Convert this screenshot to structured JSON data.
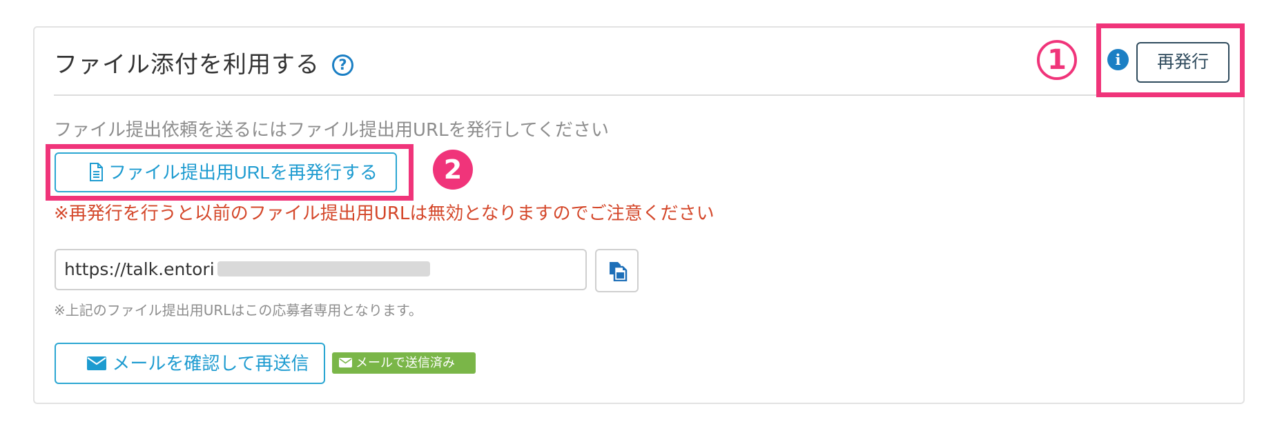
{
  "panel": {
    "title": "ファイル添付を利用する",
    "help_icon_glyph": "?",
    "reissue_label": "再発行",
    "info_icon_glyph": "i"
  },
  "annotations": {
    "marker_1": "1",
    "marker_2": "2",
    "color": "#f0347a"
  },
  "upload": {
    "instruction": "ファイル提出依頼を送るにはファイル提出用URLを発行してください",
    "reissue_url_label": "ファイル提出用URLを再発行する",
    "warning": "※再発行を行うと以前のファイル提出用URLは無効となりますのでご注意ください",
    "url_value": "https://talk.entori",
    "url_note": "※上記のファイル提出用URLはこの応募者専用となります。"
  },
  "mail": {
    "resend_label": "メールを確認して再送信",
    "sent_badge": "メールで送信済み"
  },
  "icons": {
    "help": "question-circle-icon",
    "info": "info-circle-icon",
    "document": "document-icon",
    "copy": "copy-icon",
    "mail": "envelope-icon"
  },
  "colors": {
    "accent": "#1d9bd0",
    "warning": "#d4472a",
    "badge": "#7ab648",
    "dark_button": "#2e4a5c"
  }
}
